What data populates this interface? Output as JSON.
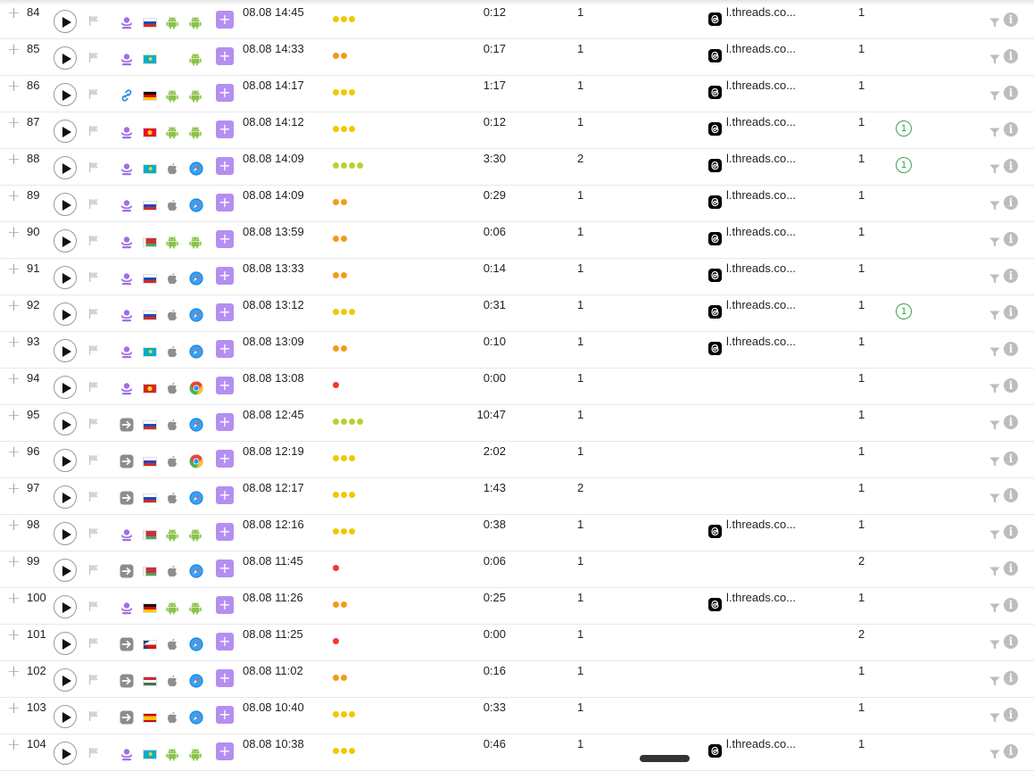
{
  "icons": {
    "row_expand": "plus-icon",
    "play": "play-icon",
    "mark": "flag-icon",
    "filter": "filter-icon",
    "info": "info-icon",
    "referrer": "threads-icon"
  },
  "colors": {
    "dot_red": "#ee3a2c",
    "dot_orange": "#f39a1b",
    "dot_yellow": "#f3c700",
    "dot_green": "#b3d334",
    "goal_green": "#3aa04a",
    "tag_purple": "#b48ff0"
  },
  "sessions": [
    {
      "num": "84",
      "source": "user",
      "country": "ru",
      "os": "android",
      "browser": "android",
      "datetime": "08.08 14:45",
      "activity": 3,
      "duration": "0:12",
      "pages": "1",
      "referrer": "l.threads.co...",
      "visits": "1",
      "goals": ""
    },
    {
      "num": "85",
      "source": "user",
      "country": "kz",
      "os": "",
      "browser": "android",
      "datetime": "08.08 14:33",
      "activity": 2,
      "duration": "0:17",
      "pages": "1",
      "referrer": "l.threads.co...",
      "visits": "1",
      "goals": ""
    },
    {
      "num": "86",
      "source": "link",
      "country": "de",
      "os": "android",
      "browser": "android",
      "datetime": "08.08 14:17",
      "activity": 3,
      "duration": "1:17",
      "pages": "1",
      "referrer": "l.threads.co...",
      "visits": "1",
      "goals": ""
    },
    {
      "num": "87",
      "source": "user",
      "country": "kg",
      "os": "android",
      "browser": "android",
      "datetime": "08.08 14:12",
      "activity": 3,
      "duration": "0:12",
      "pages": "1",
      "referrer": "l.threads.co...",
      "visits": "1",
      "goals": "1"
    },
    {
      "num": "88",
      "source": "user",
      "country": "kz",
      "os": "apple",
      "browser": "safari",
      "datetime": "08.08 14:09",
      "activity": 4,
      "duration": "3:30",
      "pages": "2",
      "referrer": "l.threads.co...",
      "visits": "1",
      "goals": "1"
    },
    {
      "num": "89",
      "source": "user",
      "country": "ru",
      "os": "apple",
      "browser": "safari",
      "datetime": "08.08 14:09",
      "activity": 2,
      "duration": "0:29",
      "pages": "1",
      "referrer": "l.threads.co...",
      "visits": "1",
      "goals": ""
    },
    {
      "num": "90",
      "source": "user",
      "country": "by",
      "os": "android",
      "browser": "android",
      "datetime": "08.08 13:59",
      "activity": 2,
      "duration": "0:06",
      "pages": "1",
      "referrer": "l.threads.co...",
      "visits": "1",
      "goals": ""
    },
    {
      "num": "91",
      "source": "user",
      "country": "ru",
      "os": "apple",
      "browser": "safari",
      "datetime": "08.08 13:33",
      "activity": 2,
      "duration": "0:14",
      "pages": "1",
      "referrer": "l.threads.co...",
      "visits": "1",
      "goals": ""
    },
    {
      "num": "92",
      "source": "user",
      "country": "ru",
      "os": "apple",
      "browser": "safari",
      "datetime": "08.08 13:12",
      "activity": 3,
      "duration": "0:31",
      "pages": "1",
      "referrer": "l.threads.co...",
      "visits": "1",
      "goals": "1"
    },
    {
      "num": "93",
      "source": "user",
      "country": "kz",
      "os": "apple",
      "browser": "safari",
      "datetime": "08.08 13:09",
      "activity": 2,
      "duration": "0:10",
      "pages": "1",
      "referrer": "l.threads.co...",
      "visits": "1",
      "goals": ""
    },
    {
      "num": "94",
      "source": "user",
      "country": "vn",
      "os": "apple",
      "browser": "chrome",
      "datetime": "08.08 13:08",
      "activity": 1,
      "duration": "0:00",
      "pages": "1",
      "referrer": "",
      "visits": "1",
      "goals": ""
    },
    {
      "num": "95",
      "source": "direct",
      "country": "ru",
      "os": "apple",
      "browser": "safari",
      "datetime": "08.08 12:45",
      "activity": 4,
      "duration": "10:47",
      "pages": "1",
      "referrer": "",
      "visits": "1",
      "goals": ""
    },
    {
      "num": "96",
      "source": "direct",
      "country": "ru",
      "os": "apple",
      "browser": "chrome",
      "datetime": "08.08 12:19",
      "activity": 3,
      "duration": "2:02",
      "pages": "1",
      "referrer": "",
      "visits": "1",
      "goals": ""
    },
    {
      "num": "97",
      "source": "direct",
      "country": "ru",
      "os": "apple",
      "browser": "safari",
      "datetime": "08.08 12:17",
      "activity": 3,
      "duration": "1:43",
      "pages": "2",
      "referrer": "",
      "visits": "1",
      "goals": ""
    },
    {
      "num": "98",
      "source": "user",
      "country": "by",
      "os": "android",
      "browser": "android",
      "datetime": "08.08 12:16",
      "activity": 3,
      "duration": "0:38",
      "pages": "1",
      "referrer": "l.threads.co...",
      "visits": "1",
      "goals": ""
    },
    {
      "num": "99",
      "source": "direct",
      "country": "by",
      "os": "apple",
      "browser": "safari",
      "datetime": "08.08 11:45",
      "activity": 1,
      "duration": "0:06",
      "pages": "1",
      "referrer": "",
      "visits": "2",
      "goals": ""
    },
    {
      "num": "100",
      "source": "user",
      "country": "de",
      "os": "android",
      "browser": "android",
      "datetime": "08.08 11:26",
      "activity": 2,
      "duration": "0:25",
      "pages": "1",
      "referrer": "l.threads.co...",
      "visits": "1",
      "goals": ""
    },
    {
      "num": "101",
      "source": "direct",
      "country": "cz",
      "os": "apple",
      "browser": "safari",
      "datetime": "08.08 11:25",
      "activity": 1,
      "duration": "0:00",
      "pages": "1",
      "referrer": "",
      "visits": "2",
      "goals": ""
    },
    {
      "num": "102",
      "source": "direct",
      "country": "hu",
      "os": "apple",
      "browser": "safari",
      "datetime": "08.08 11:02",
      "activity": 2,
      "duration": "0:16",
      "pages": "1",
      "referrer": "",
      "visits": "1",
      "goals": ""
    },
    {
      "num": "103",
      "source": "direct",
      "country": "es",
      "os": "apple",
      "browser": "safari",
      "datetime": "08.08 10:40",
      "activity": 3,
      "duration": "0:33",
      "pages": "1",
      "referrer": "",
      "visits": "1",
      "goals": ""
    },
    {
      "num": "104",
      "source": "user",
      "country": "kz",
      "os": "android",
      "browser": "android",
      "datetime": "08.08 10:38",
      "activity": 3,
      "duration": "0:46",
      "pages": "1",
      "referrer": "l.threads.co...",
      "visits": "1",
      "goals": ""
    }
  ]
}
